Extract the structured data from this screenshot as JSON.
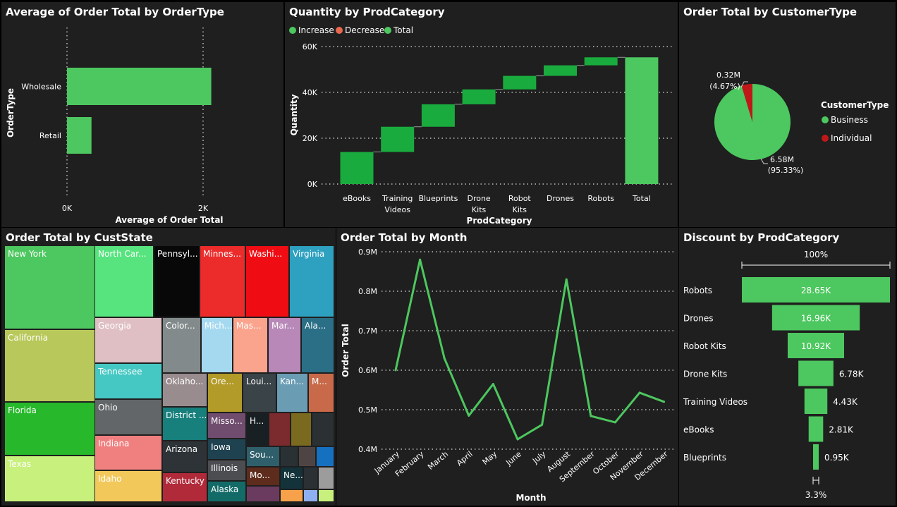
{
  "colors": {
    "background": "#1f1f1f",
    "green": "#4dc75f",
    "dark_green": "#1aab3e",
    "red": "#c01818",
    "decrease": "#e8674f"
  },
  "panels": {
    "ordertype": {
      "title": "Average of Order Total by OrderType"
    },
    "prodcategory": {
      "title": "Quantity by ProdCategory"
    },
    "customertype": {
      "title": "Order Total by CustomerType"
    },
    "custstate": {
      "title": "Order Total by CustState"
    },
    "month": {
      "title": "Order Total by Month"
    },
    "discount": {
      "title": "Discount by ProdCategory"
    }
  },
  "chart_data": [
    {
      "id": "ordertype",
      "type": "bar",
      "orientation": "horizontal",
      "title": "Average of Order Total by OrderType",
      "categories": [
        "Wholesale",
        "Retail"
      ],
      "values": [
        2120,
        360
      ],
      "xlabel": "Average of Order Total",
      "ylabel": "OrderType",
      "xticks": [
        "0K",
        "2K"
      ],
      "xlim": [
        0,
        2000
      ],
      "grid": "vertical dotted"
    },
    {
      "id": "prodcategory",
      "type": "bar",
      "subtype": "waterfall",
      "title": "Quantity by ProdCategory",
      "categories": [
        "eBooks",
        "Training Videos",
        "Blueprints",
        "Drone Kits",
        "Robot Kits",
        "Drones",
        "Robots",
        "Total"
      ],
      "tick_labels": [
        [
          "eBooks"
        ],
        [
          "Training",
          "Videos"
        ],
        [
          "Blueprints"
        ],
        [
          "Drone",
          "Kits"
        ],
        [
          "Robot",
          "Kits"
        ],
        [
          "Drones"
        ],
        [
          "Robots"
        ],
        [
          "Total"
        ]
      ],
      "values": [
        14000,
        11000,
        9800,
        6500,
        5900,
        4600,
        3500,
        55300
      ],
      "legend": [
        "Increase",
        "Decrease",
        "Total"
      ],
      "legend_position": "top-left",
      "xlabel": "ProdCategory",
      "ylabel": "Quantity",
      "yticks": [
        "0K",
        "20K",
        "40K",
        "60K"
      ],
      "ylim": [
        0,
        60000
      ]
    },
    {
      "id": "customertype",
      "type": "pie",
      "title": "Order Total by CustomerType",
      "legend_title": "CustomerType",
      "legend_position": "right",
      "categories": [
        "Business",
        "Individual"
      ],
      "values": [
        6.58,
        0.32
      ],
      "labels": [
        [
          "6.58M",
          "(95.33%)"
        ],
        [
          "0.32M",
          "(4.67%)"
        ]
      ],
      "unit": "M"
    },
    {
      "id": "custstate",
      "type": "treemap",
      "title": "Order Total by CustState",
      "labels": [
        "New York",
        "California",
        "Florida",
        "Texas",
        "North Car...",
        "Georgia",
        "Tennessee",
        "Ohio",
        "Indiana",
        "Idaho",
        "Pennsyl...",
        "Minnes...",
        "Washi...",
        "Virginia",
        "Color...",
        "Mich...",
        "Mas...",
        "Mar...",
        "Ala...",
        "Oklaho...",
        "Ore...",
        "Loui...",
        "Kan...",
        "M...",
        "District ...",
        "Misso...",
        "H...",
        "Arizona",
        "Iowa",
        "Illinois",
        "Sou...",
        "Kentucky",
        "Alaska",
        "Mo...",
        "Ne..."
      ]
    },
    {
      "id": "month",
      "type": "line",
      "title": "Order Total by Month",
      "categories": [
        "January",
        "February",
        "March",
        "April",
        "May",
        "June",
        "July",
        "August",
        "September",
        "October",
        "November",
        "December"
      ],
      "values": [
        0.6,
        0.88,
        0.63,
        0.485,
        0.565,
        0.425,
        0.462,
        0.83,
        0.484,
        0.468,
        0.543,
        0.52
      ],
      "xlabel": "Month",
      "ylabel": "Order Total",
      "yticks": [
        "0.4M",
        "0.5M",
        "0.6M",
        "0.7M",
        "0.8M",
        "0.9M"
      ],
      "ylim": [
        0.4,
        0.9
      ],
      "unit": "M"
    },
    {
      "id": "discount",
      "type": "bar",
      "subtype": "funnel",
      "title": "Discount by ProdCategory",
      "categories": [
        "Robots",
        "Drones",
        "Robot Kits",
        "Drone Kits",
        "Training Videos",
        "eBooks",
        "Blueprints"
      ],
      "values": [
        28.65,
        16.96,
        10.92,
        6.78,
        4.43,
        2.81,
        0.95
      ],
      "value_labels": [
        "28.65K",
        "16.96K",
        "10.92K",
        "6.78K",
        "4.43K",
        "2.81K",
        "0.95K"
      ],
      "top_percent": "100%",
      "bottom_percent": "3.3%",
      "unit": "K"
    }
  ]
}
